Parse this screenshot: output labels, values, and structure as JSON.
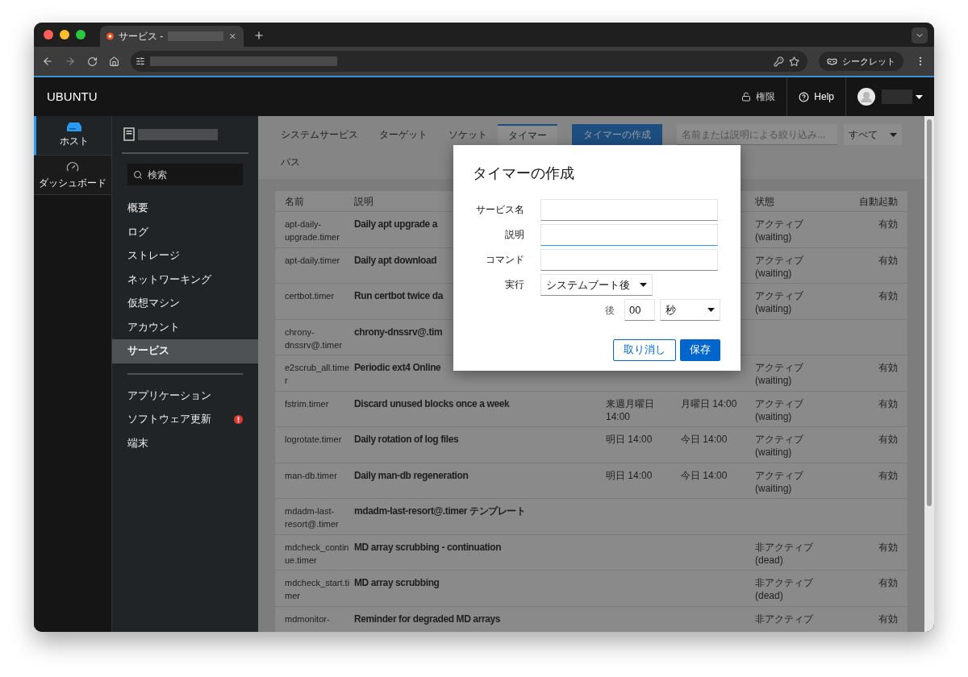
{
  "browser": {
    "tab_title": "サービス -",
    "incognito_label": "シークレット"
  },
  "topbar": {
    "brand": "UBUNTU",
    "privileges": "権限",
    "help": "Help"
  },
  "host_nav": [
    {
      "label": "ホスト",
      "kind": "host",
      "selected": true
    },
    {
      "label": "ダッシュボード",
      "kind": "dashboard",
      "selected": false
    }
  ],
  "menu_search": {
    "placeholder": "検索"
  },
  "menu_groups": [
    [
      {
        "label": "概要",
        "selected": false,
        "alert": false
      },
      {
        "label": "ログ",
        "selected": false,
        "alert": false
      },
      {
        "label": "ストレージ",
        "selected": false,
        "alert": false
      },
      {
        "label": "ネットワーキング",
        "selected": false,
        "alert": false
      },
      {
        "label": "仮想マシン",
        "selected": false,
        "alert": false
      },
      {
        "label": "アカウント",
        "selected": false,
        "alert": false
      },
      {
        "label": "サービス",
        "selected": true,
        "alert": false
      }
    ],
    [
      {
        "label": "アプリケーション",
        "selected": false,
        "alert": false
      },
      {
        "label": "ソフトウェア更新",
        "selected": false,
        "alert": true
      },
      {
        "label": "端末",
        "selected": false,
        "alert": false
      }
    ]
  ],
  "tabs": [
    {
      "label": "システムサービス",
      "selected": false
    },
    {
      "label": "ターゲット",
      "selected": false
    },
    {
      "label": "ソケット",
      "selected": false
    },
    {
      "label": "タイマー",
      "selected": true
    },
    {
      "label": "パス",
      "selected": false
    }
  ],
  "create_button": "タイマーの作成",
  "filter": {
    "placeholder": "名前または説明による絞り込み...",
    "select": "すべて"
  },
  "table": {
    "columns": {
      "name": "名前",
      "description": "説明",
      "status": "状態",
      "autostart": "自動起動"
    },
    "rows": [
      {
        "name": "apt-daily-upgrade.timer",
        "description": "Daily apt upgrade a",
        "status": "アクティブ",
        "substate": "(waiting)",
        "autostart": "有効"
      },
      {
        "name": "apt-daily.timer",
        "description": "Daily apt download",
        "status": "アクティブ",
        "substate": "(waiting)",
        "autostart": "有効"
      },
      {
        "name": "certbot.timer",
        "description": "Run certbot twice da",
        "status": "アクティブ",
        "substate": "(waiting)",
        "autostart": "有効"
      },
      {
        "name": "chrony-dnssrv@.timer",
        "description": "chrony-dnssrv@.tim"
      },
      {
        "name": "e2scrub_all.timer",
        "description": "Periodic ext4 Online",
        "status": "アクティブ",
        "substate": "(waiting)",
        "autostart": "有効"
      },
      {
        "name": "fstrim.timer",
        "description": "Discard unused blocks once a week",
        "next": "来週月曜日 14:00",
        "last": "月曜日 14:00",
        "status": "アクティブ",
        "substate": "(waiting)",
        "autostart": "有効"
      },
      {
        "name": "logrotate.timer",
        "description": "Daily rotation of log files",
        "next": "明日 14:00",
        "last": "今日 14:00",
        "status": "アクティブ",
        "substate": "(waiting)",
        "autostart": "有効"
      },
      {
        "name": "man-db.timer",
        "description": "Daily man-db regeneration",
        "next": "明日 14:00",
        "last": "今日 14:00",
        "status": "アクティブ",
        "substate": "(waiting)",
        "autostart": "有効"
      },
      {
        "name": "mdadm-last-resort@.timer",
        "description": "mdadm-last-resort@.timer テンプレート"
      },
      {
        "name": "mdcheck_continue.timer",
        "description": "MD array scrubbing - continuation",
        "status": "非アクティブ",
        "substate": "(dead)",
        "autostart": "有効"
      },
      {
        "name": "mdcheck_start.timer",
        "description": "MD array scrubbing",
        "status": "非アクティブ",
        "substate": "(dead)",
        "autostart": "有効"
      },
      {
        "name": "mdmonitor-",
        "description": "Reminder for degraded MD arrays",
        "status": "非アクティブ",
        "autostart": "有効"
      }
    ]
  },
  "dialog": {
    "title": "タイマーの作成",
    "fields": [
      {
        "label": "サービス名",
        "focused": false
      },
      {
        "label": "説明",
        "focused": true
      },
      {
        "label": "コマンド",
        "focused": false
      }
    ],
    "run": {
      "label": "実行",
      "select": "システムブート後",
      "after": "後",
      "amount": "00",
      "unit": "秒"
    },
    "cancel": "取り消し",
    "save": "保存"
  }
}
